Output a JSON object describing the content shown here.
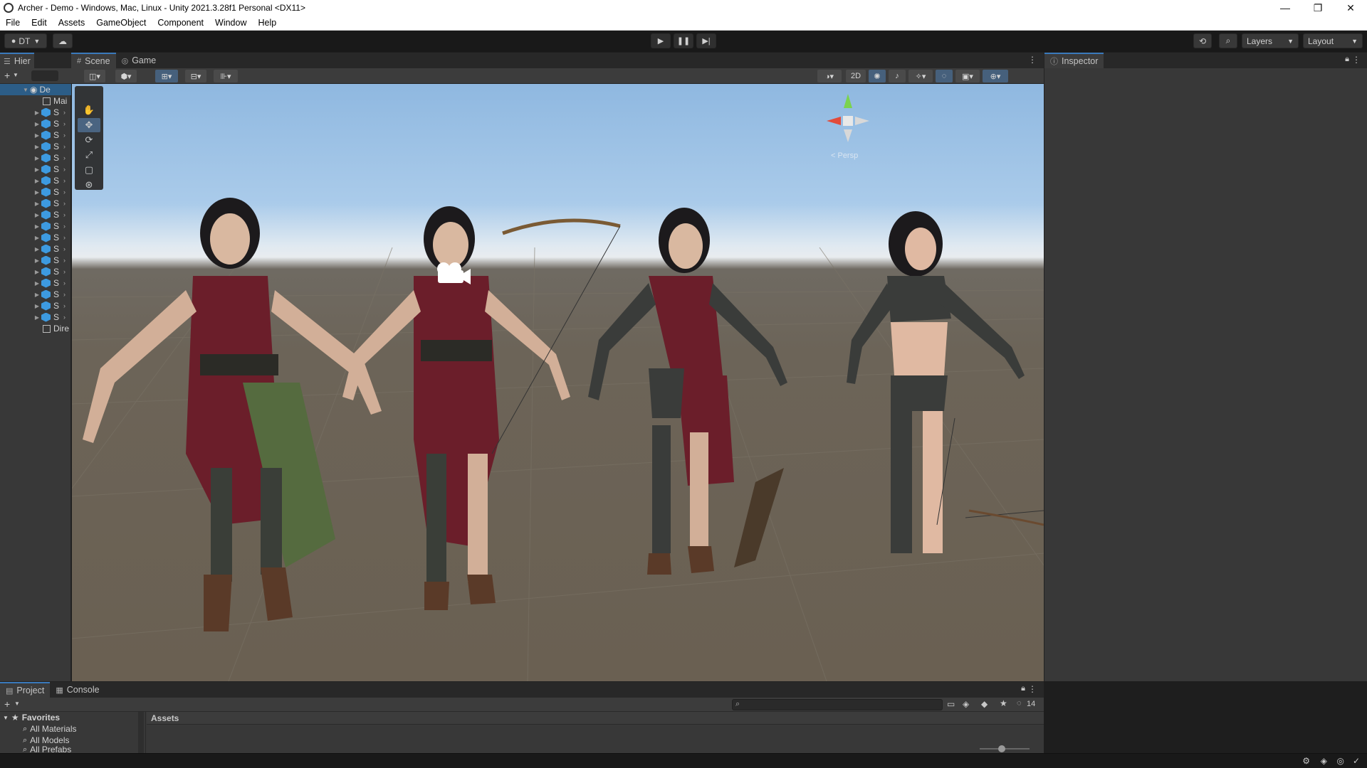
{
  "window": {
    "title": "Archer - Demo - Windows, Mac, Linux - Unity 2021.3.28f1 Personal <DX11>",
    "controls": [
      "—",
      "❐",
      "✕"
    ]
  },
  "menu": [
    "File",
    "Edit",
    "Assets",
    "GameObject",
    "Component",
    "Window",
    "Help"
  ],
  "toolbar": {
    "account_label": "DT",
    "layers_label": "Layers",
    "layout_label": "Layout"
  },
  "hierarchy": {
    "tab_label": "Hier",
    "scene_label": "De",
    "camera_label": "Mai",
    "object_label": "S",
    "light_label": "Dire",
    "item_count": 19
  },
  "scene": {
    "tab_scene": "Scene",
    "tab_game": "Game",
    "btn_2d": "2D",
    "persp_label": "< Persp"
  },
  "inspector": {
    "tab_label": "Inspector"
  },
  "project": {
    "tab_project": "Project",
    "tab_console": "Console",
    "favorites_label": "Favorites",
    "favorites": [
      "All Materials",
      "All Models",
      "All Prefabs"
    ],
    "assets_header": "Assets",
    "hidden_count": "14"
  },
  "colors": {
    "accent": "#3a79bb",
    "selected": "#46607c",
    "panel": "#383838",
    "toolbar": "#191919"
  }
}
